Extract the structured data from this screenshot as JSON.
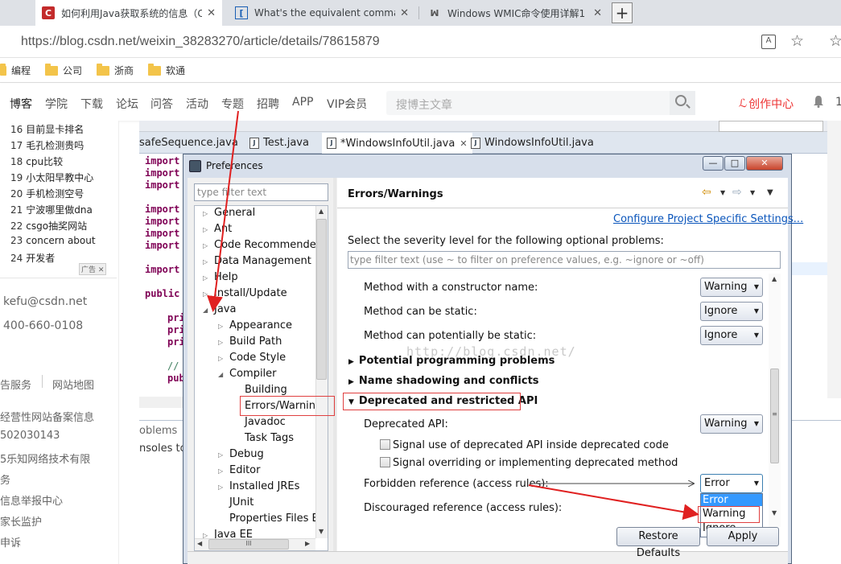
{
  "browser": {
    "tabs": [
      {
        "label": "如何利用Java获取系统的信息（C",
        "close": "✕",
        "favicon": "C"
      },
      {
        "label": "What's the equivalent command",
        "close": "✕",
        "favicon": "["
      },
      {
        "label": "Windows WMIC命令使用详解1 -",
        "close": "✕",
        "favicon": "ꟽ"
      }
    ],
    "new_tab": "+",
    "url_host": "https://blog.csdn.net",
    "url_path": "/weixin_38283270/article/details/78615879",
    "bookmarks": [
      "编程",
      "公司",
      "浙商",
      "软通"
    ]
  },
  "csdn": {
    "nav": [
      "博客",
      "学院",
      "下载",
      "论坛",
      "问答",
      "活动",
      "专题",
      "招聘",
      "APP",
      "VIP会员"
    ],
    "search_placeholder": "搜博主文章",
    "create": "创作中心",
    "more": "1",
    "ranking": [
      {
        "n": "16",
        "t": "目前显卡排名"
      },
      {
        "n": "17",
        "t": "毛孔检测贵吗"
      },
      {
        "n": "18",
        "t": "cpu比较"
      },
      {
        "n": "19",
        "t": "小太阳早教中心"
      },
      {
        "n": "20",
        "t": "手机检测空号"
      },
      {
        "n": "21",
        "t": "宁波哪里做dna"
      },
      {
        "n": "22",
        "t": "csgo抽奖网站"
      },
      {
        "n": "23",
        "t": "concern about"
      },
      {
        "n": "24",
        "t": "开发者"
      }
    ],
    "ad_label": "广告",
    "email": "kefu@csdn.net",
    "phone": "400-660-0108",
    "footer_links": [
      "告服务",
      "网站地图"
    ],
    "footer_lines": [
      "经营性网站备案信息",
      "502030143",
      "5乐知网络技术有限",
      "务",
      "信息举报中心",
      "家长监护",
      "申诉"
    ]
  },
  "eclipse": {
    "editor_tabs": [
      "safeSequence.java",
      "Test.java",
      "*WindowsInfoUtil.java",
      "WindowsInfoUtil.java"
    ],
    "editor_tab_close": "✕",
    "code_lines": [
      "import",
      "import",
      "import",
      "import",
      "import",
      "import",
      "import",
      "import",
      "public",
      "pri",
      "pri",
      "pri",
      "//",
      "pub"
    ],
    "bottom_panel": [
      "oblems",
      "nsoles to"
    ]
  },
  "preferences": {
    "title": "Preferences",
    "window_buttons": [
      "—",
      "□",
      "✕"
    ],
    "filter_placeholder": "type filter text",
    "tree": [
      {
        "label": "General",
        "expand": "▷"
      },
      {
        "label": "Ant",
        "expand": "▷"
      },
      {
        "label": "Code Recommenders",
        "expand": "▷"
      },
      {
        "label": "Data Management",
        "expand": "▷"
      },
      {
        "label": "Help",
        "expand": "▷"
      },
      {
        "label": "Install/Update",
        "expand": "▷"
      },
      {
        "label": "Java",
        "expand": "◢"
      },
      {
        "label": "Appearance",
        "expand": "▷"
      },
      {
        "label": "Build Path",
        "expand": "▷"
      },
      {
        "label": "Code Style",
        "expand": "▷"
      },
      {
        "label": "Compiler",
        "expand": "◢"
      },
      {
        "label": "Building",
        "expand": ""
      },
      {
        "label": "Errors/Warnings",
        "expand": ""
      },
      {
        "label": "Javadoc",
        "expand": ""
      },
      {
        "label": "Task Tags",
        "expand": ""
      },
      {
        "label": "Debug",
        "expand": "▷"
      },
      {
        "label": "Editor",
        "expand": "▷"
      },
      {
        "label": "Installed JREs",
        "expand": "▷"
      },
      {
        "label": "JUnit",
        "expand": ""
      },
      {
        "label": "Properties Files Ed",
        "expand": ""
      },
      {
        "label": "Java EE",
        "expand": "▷"
      }
    ],
    "page_title": "Errors/Warnings",
    "config_link": "Configure Project Specific Settings...",
    "severity_label": "Select the severity level for the following optional problems:",
    "options_filter_placeholder": "type filter text (use ~ to filter on preference values, e.g. ~ignore or ~off)",
    "rows": [
      {
        "label": "Method with a constructor name:",
        "value": "Warning"
      },
      {
        "label": "Method can be static:",
        "value": "Ignore"
      },
      {
        "label": "Method can potentially be static:",
        "value": "Ignore"
      }
    ],
    "sections": [
      {
        "label": "Potential programming problems",
        "arrow": "▶"
      },
      {
        "label": "Name shadowing and conflicts",
        "arrow": "▶"
      },
      {
        "label": "Deprecated and restricted API",
        "arrow": "▼"
      }
    ],
    "deprecated_api": {
      "label": "Deprecated API:",
      "value": "Warning"
    },
    "checkboxes": [
      "Signal use of deprecated API inside deprecated code",
      "Signal overriding or implementing deprecated method"
    ],
    "forbidden": {
      "label": "Forbidden reference (access rules):",
      "value": "Error"
    },
    "discouraged": {
      "label": "Discouraged reference (access rules):"
    },
    "dropdown_options": [
      "Error",
      "Warning",
      "Ignore"
    ],
    "dropdown_selected": "Error",
    "buttons": {
      "restore": "Restore Defaults",
      "apply": "Apply"
    }
  },
  "watermark": "http://blog.csdn.net/",
  "colors": {
    "accent_red": "#e33b3b",
    "link_blue": "#0a55bb",
    "selection": "#3399ff"
  }
}
